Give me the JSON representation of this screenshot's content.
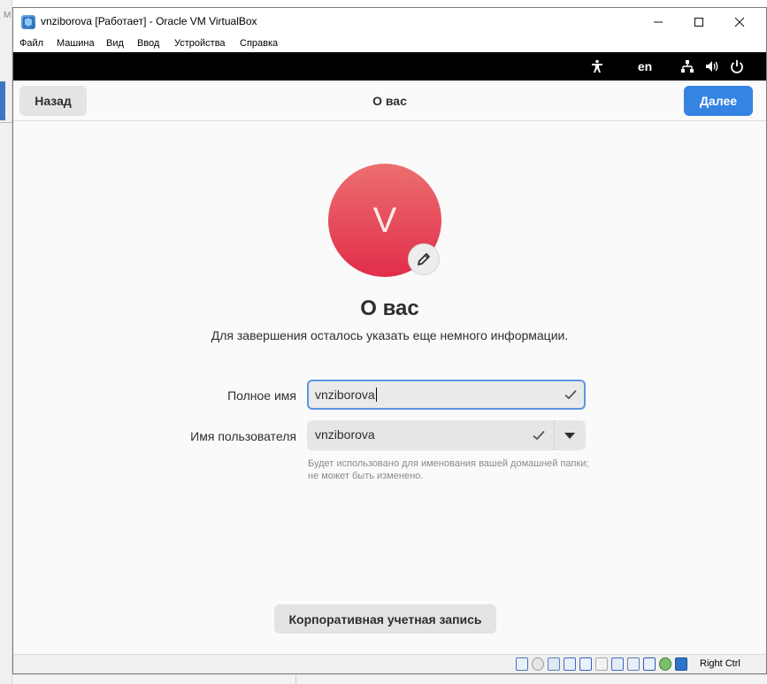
{
  "window": {
    "title": "vnziborova [Работает] - Oracle VM VirtualBox",
    "icon_name": "virtualbox-icon",
    "controls": {
      "minimize": "—",
      "maximize": "☐",
      "close": "✕"
    }
  },
  "menu": [
    {
      "label": "Файл"
    },
    {
      "label": "Машина"
    },
    {
      "label": "Вид"
    },
    {
      "label": "Ввод"
    },
    {
      "label": "Устройства"
    },
    {
      "label": "Справка"
    }
  ],
  "guest_topbar": {
    "language": "en",
    "icons": [
      "accessibility-icon",
      "network-icon",
      "volume-icon",
      "power-icon"
    ]
  },
  "header": {
    "back_label": "Назад",
    "title": "О вас",
    "next_label": "Далее"
  },
  "avatar": {
    "initial": "V",
    "edit_icon": "pencil-icon"
  },
  "main": {
    "heading": "О вас",
    "subheading": "Для завершения осталось указать еще немного информации."
  },
  "form": {
    "fullname_label": "Полное имя",
    "fullname_value": "vnziborova",
    "username_label": "Имя пользователя",
    "username_value": "vnziborova",
    "hint": "Будет использовано для именования вашей домашней папки; не может быть изменено."
  },
  "enterprise_button": "Корпоративная учетная запись",
  "statusbar": {
    "host_key": "Right Ctrl"
  },
  "colors": {
    "accent": "#3584e4",
    "avatar_top": "#ec6f6f",
    "avatar_bottom": "#e12d4b"
  }
}
